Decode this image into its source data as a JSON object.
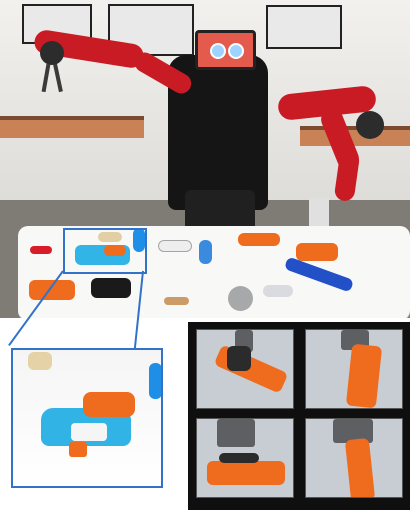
{
  "image": {
    "scene": "robot-scene",
    "zoom": "zoomed-grasp-object",
    "grasps": [
      {
        "pose": "diagonal-orange-gun",
        "color": "#ef6b1d"
      },
      {
        "pose": "upright-orange-gun",
        "color": "#ef6b1d"
      },
      {
        "pose": "side-orange-gun",
        "color": "#ef6b1d"
      },
      {
        "pose": "vertical-orange-gun",
        "color": "#ef6b1d"
      }
    ],
    "accent": "#3273c9"
  }
}
